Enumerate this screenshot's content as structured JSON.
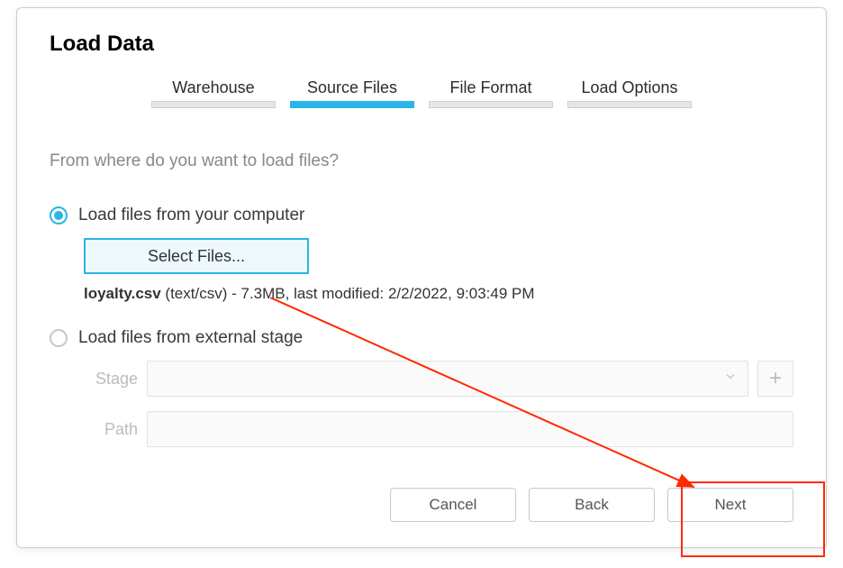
{
  "dialog": {
    "title": "Load Data",
    "prompt": "From where do you want to load files?"
  },
  "stepper": {
    "steps": [
      {
        "label": "Warehouse",
        "active": false
      },
      {
        "label": "Source Files",
        "active": true
      },
      {
        "label": "File Format",
        "active": false
      },
      {
        "label": "Load Options",
        "active": false
      }
    ]
  },
  "options": {
    "computer": {
      "label": "Load files from your computer",
      "selected": true,
      "select_button": "Select Files...",
      "file": {
        "name": "loyalty.csv",
        "mime": "(text/csv)",
        "sep": " - ",
        "size": "7.3MB",
        "modified_prefix": ", last modified: ",
        "modified": "2/2/2022, 9:03:49 PM"
      }
    },
    "external": {
      "label": "Load files from external stage",
      "selected": false,
      "stage_label": "Stage",
      "path_label": "Path",
      "path_value": ""
    }
  },
  "footer": {
    "cancel": "Cancel",
    "back": "Back",
    "next": "Next"
  }
}
